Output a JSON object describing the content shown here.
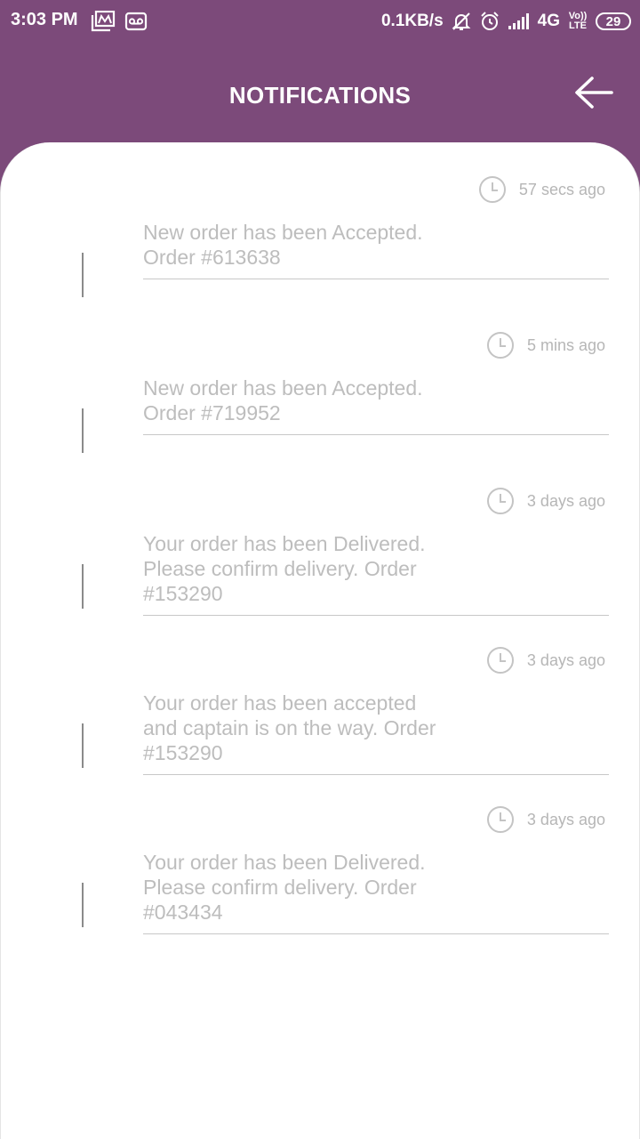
{
  "status_bar": {
    "time": "3:03 PM",
    "net_speed": "0.1KB/s",
    "network": "4G",
    "volte": "Vo)) LTE",
    "battery": "29"
  },
  "header": {
    "title": "NOTIFICATIONS"
  },
  "notifications": [
    {
      "time": "57 secs ago",
      "message": "New order has been Accepted. Order #613638"
    },
    {
      "time": "5 mins ago",
      "message": "New order has been Accepted. Order #719952"
    },
    {
      "time": "3 days ago",
      "message": "Your order has been Delivered. Please confirm delivery. Order #153290"
    },
    {
      "time": "3 days ago",
      "message": "Your order has been accepted and captain is on the way. Order #153290"
    },
    {
      "time": "3 days ago",
      "message": "Your order has been Delivered. Please confirm delivery. Order #043434"
    }
  ]
}
